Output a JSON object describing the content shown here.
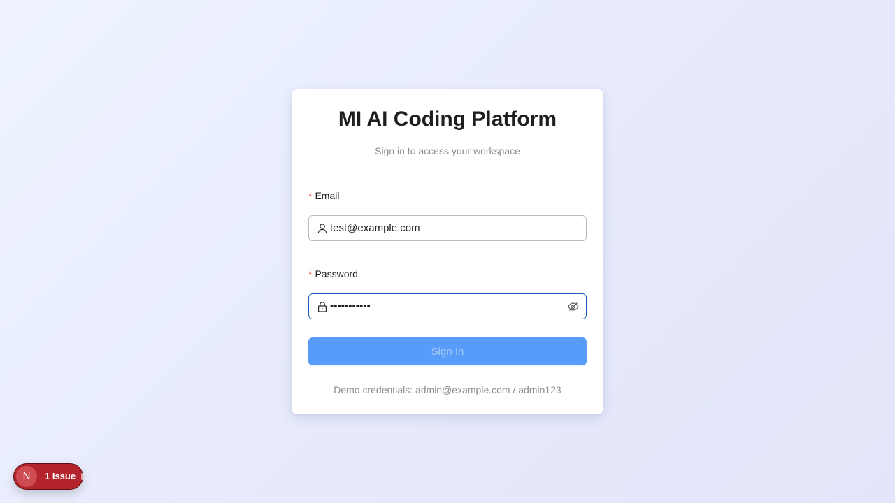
{
  "login": {
    "title": "MI AI Coding Platform",
    "subtitle": "Sign in to access your workspace",
    "email": {
      "required_mark": "*",
      "label": "Email",
      "value": "test@example.com",
      "icon": "user-icon"
    },
    "password": {
      "required_mark": "*",
      "label": "Password",
      "value": "•••••••••••",
      "icon": "lock-icon",
      "toggle_icon": "eye-off-icon"
    },
    "submit_label": "Sign In",
    "demo_credentials": "Demo credentials: admin@example.com / admin123"
  },
  "dev_indicator": {
    "logo_letter": "N",
    "issues_label": "1 Issue"
  },
  "colors": {
    "primary_button": "#589cfa",
    "focus_border": "#1d5fb8",
    "required": "#ff4d4f",
    "issue_badge": "#b3242c"
  }
}
